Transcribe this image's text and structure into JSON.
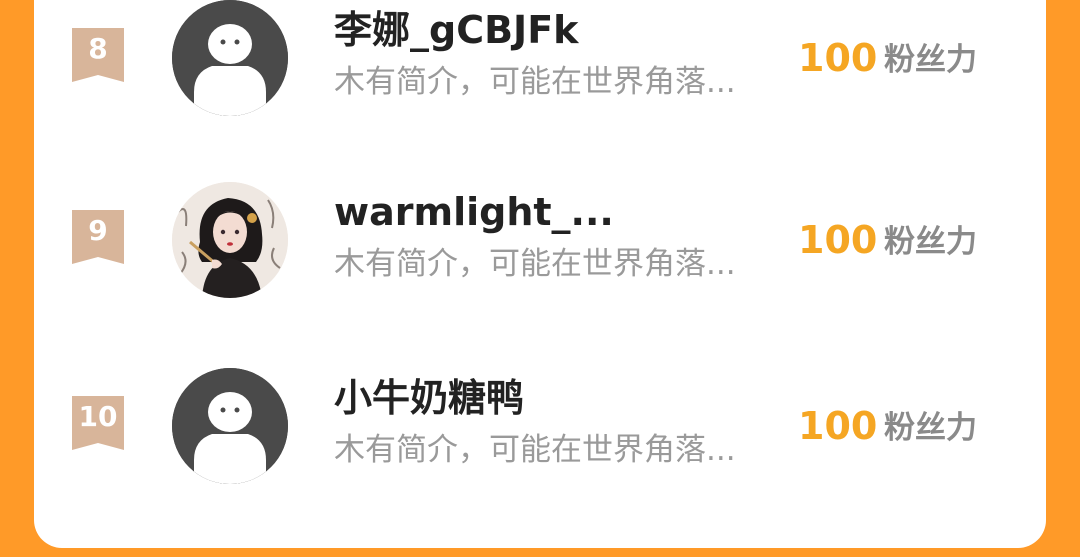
{
  "theme": {
    "background": "#FF9A28",
    "card": "#ffffff",
    "score_color": "#F5A623",
    "rank_badge_color": "#D8B59A",
    "default_avatar_color": "#4a4a4a"
  },
  "leaderboard": {
    "items": [
      {
        "rank": "8",
        "name": "李娜_gCBJFk",
        "bio": "木有简介，可能在世界角落...",
        "score": "100",
        "score_label": "粉丝力",
        "avatar": "default-avatar-icon"
      },
      {
        "rank": "9",
        "name": "warmlight_...",
        "bio": "木有简介，可能在世界角落...",
        "score": "100",
        "score_label": "粉丝力",
        "avatar": "photo-avatar"
      },
      {
        "rank": "10",
        "name": "小牛奶糖鸭",
        "bio": "木有简介，可能在世界角落...",
        "score": "100",
        "score_label": "粉丝力",
        "avatar": "default-avatar-icon"
      }
    ]
  }
}
